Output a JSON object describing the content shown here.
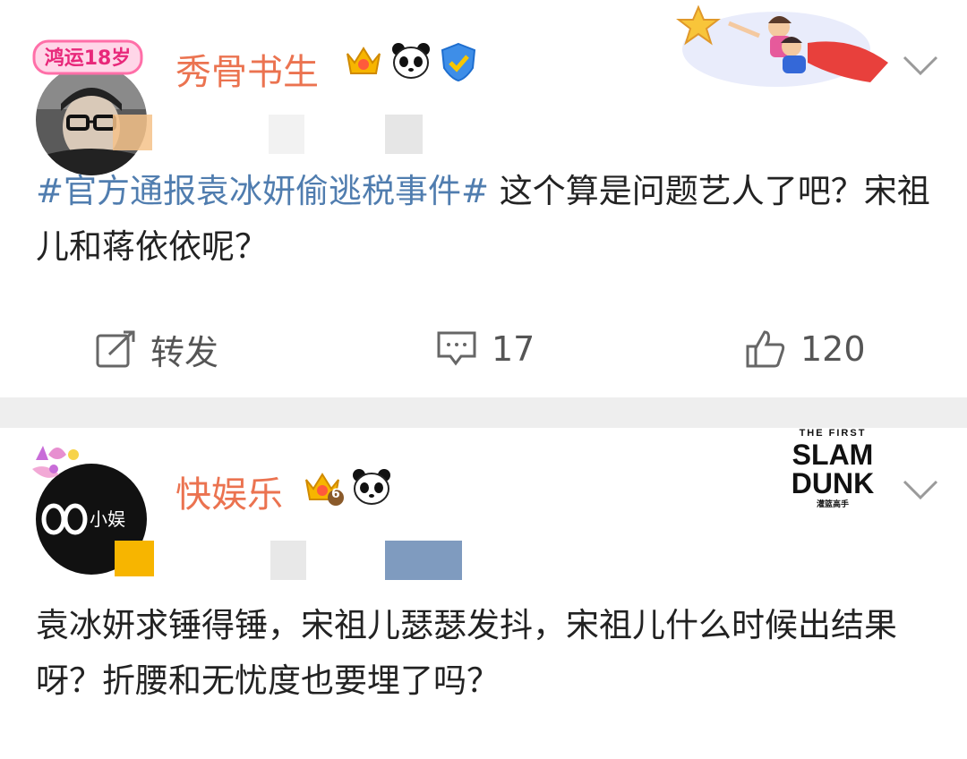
{
  "posts": [
    {
      "username": "秀骨书生",
      "avatar_badge_text": "鸿运18岁",
      "badges": [
        "crown-level-icon",
        "panda-icon",
        "verified-shield-icon"
      ],
      "topic": "#官方通报袁冰妍偷逃税事件#",
      "text": " 这个算是问题艺人了吧？宋祖儿和蒋依依呢？",
      "actions": {
        "repost_label": "转发",
        "comment_count": "17",
        "like_count": "120"
      }
    },
    {
      "username": "快娱乐",
      "avatar_text": "小娱",
      "crown_level": "6",
      "badges": [
        "crown-level-icon",
        "panda-icon"
      ],
      "header_art": {
        "line1": "THE FIRST",
        "line2": "SLAM",
        "line3": "DUNK",
        "line4": "灌篮高手"
      },
      "text": "袁冰妍求锤得锤，宋祖儿瑟瑟发抖，宋祖儿什么时候出结果呀？折腰和无忧度也要埋了吗？"
    }
  ],
  "colors": {
    "username": "#eb7350",
    "topic": "#507daf",
    "text": "#222222",
    "separator": "#eeeeee"
  }
}
